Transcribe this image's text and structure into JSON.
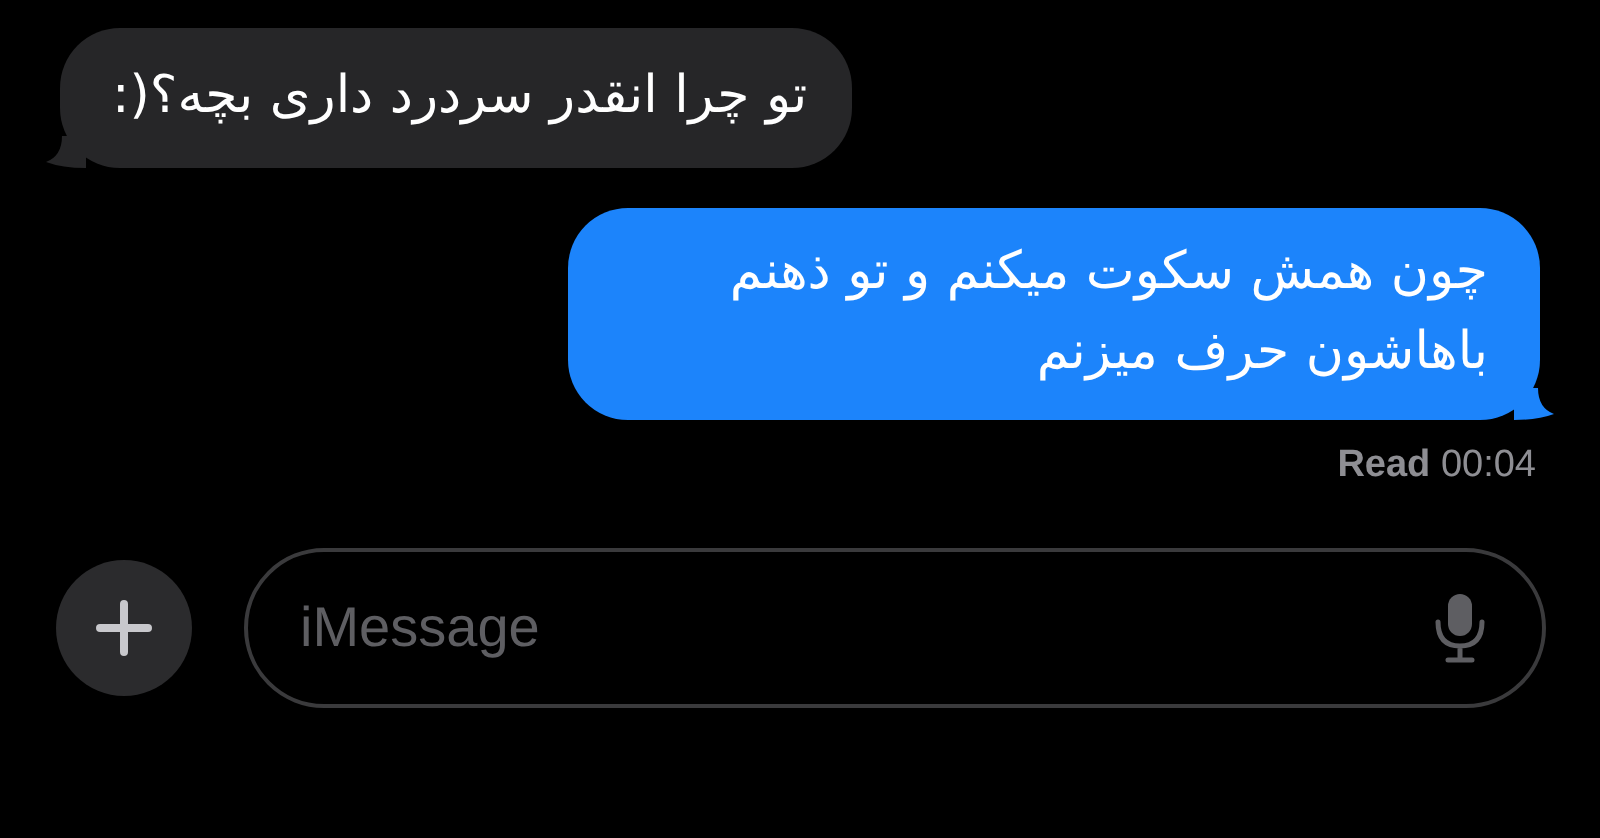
{
  "messages": [
    {
      "kind": "incoming",
      "text": "تو چرا انقدر سردرد داری بچه؟(:"
    },
    {
      "kind": "outgoing",
      "text": "چون همش سکوت میکنم و تو ذهنم باهاشون حرف میزنم"
    }
  ],
  "receipt": {
    "label": "Read",
    "time": "00:04"
  },
  "composer": {
    "placeholder": "iMessage"
  }
}
